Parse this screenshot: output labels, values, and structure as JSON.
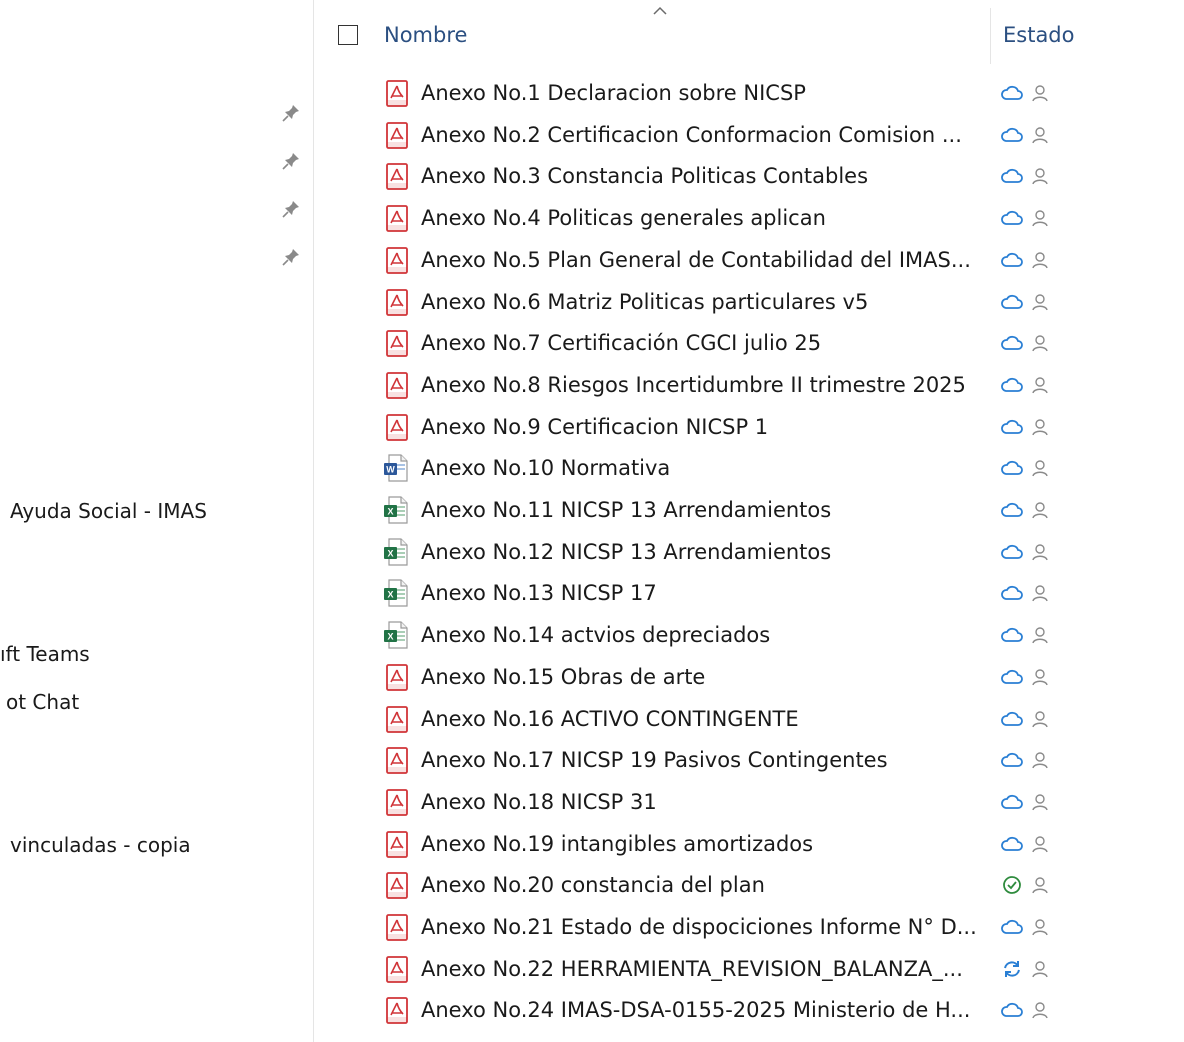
{
  "nav": {
    "items": [
      {
        "label": "Ayuda Social - IMAS"
      },
      {
        "label": "ıft Teams"
      },
      {
        "label": "ot Chat"
      },
      {
        "label": "vinculadas - copia"
      }
    ]
  },
  "header": {
    "name_label": "Nombre",
    "status_label": "Estado"
  },
  "files": [
    {
      "name": "Anexo No.1 Declaracion sobre NICSP",
      "type": "pdf",
      "status": "cloud"
    },
    {
      "name": "Anexo No.2 Certificacion Conformacion Comision ...",
      "type": "pdf",
      "status": "cloud"
    },
    {
      "name": "Anexo No.3 Constancia  Politicas Contables",
      "type": "pdf",
      "status": "cloud"
    },
    {
      "name": "Anexo No.4 Politicas generales aplican",
      "type": "pdf",
      "status": "cloud"
    },
    {
      "name": "Anexo No.5 Plan General de Contabilidad del IMAS...",
      "type": "pdf",
      "status": "cloud"
    },
    {
      "name": "Anexo No.6 Matriz Politicas particulares v5",
      "type": "pdf",
      "status": "cloud"
    },
    {
      "name": "Anexo No.7 Certificación CGCI julio 25",
      "type": "pdf",
      "status": "cloud"
    },
    {
      "name": "Anexo No.8 Riesgos Incertidumbre II trimestre 2025",
      "type": "pdf",
      "status": "cloud"
    },
    {
      "name": "Anexo No.9 Certificacion NICSP 1",
      "type": "pdf",
      "status": "cloud"
    },
    {
      "name": "Anexo No.10  Normativa",
      "type": "word",
      "status": "cloud"
    },
    {
      "name": "Anexo No.11 NICSP 13 Arrendamientos",
      "type": "excel",
      "status": "cloud"
    },
    {
      "name": "Anexo No.12 NICSP 13 Arrendamientos",
      "type": "excel",
      "status": "cloud"
    },
    {
      "name": "Anexo No.13 NICSP 17",
      "type": "excel",
      "status": "cloud"
    },
    {
      "name": "Anexo No.14 actvios depreciados",
      "type": "excel",
      "status": "cloud"
    },
    {
      "name": "Anexo No.15  Obras de arte",
      "type": "pdf",
      "status": "cloud"
    },
    {
      "name": "Anexo No.16 ACTIVO CONTINGENTE",
      "type": "pdf",
      "status": "cloud"
    },
    {
      "name": "Anexo No.17  NICSP 19 Pasivos Contingentes",
      "type": "pdf",
      "status": "cloud"
    },
    {
      "name": "Anexo No.18 NICSP 31",
      "type": "pdf",
      "status": "cloud"
    },
    {
      "name": "Anexo No.19 intangibles amortizados",
      "type": "pdf",
      "status": "cloud"
    },
    {
      "name": "Anexo No.20 constancia del plan",
      "type": "pdf",
      "status": "synced"
    },
    {
      "name": "Anexo No.21 Estado de dispociciones Informe N° D...",
      "type": "pdf",
      "status": "cloud"
    },
    {
      "name": "Anexo No.22 HERRAMIENTA_REVISION_BALANZA_...",
      "type": "pdf",
      "status": "syncing"
    },
    {
      "name": "Anexo No.24 IMAS-DSA-0155-2025 Ministerio de H...",
      "type": "pdf",
      "status": "cloud"
    }
  ],
  "colors": {
    "accent": "#2b4f81",
    "cloud": "#2a7fd4",
    "synced": "#2e8b3d",
    "pdf": "#d13438",
    "word": "#2b579a",
    "excel": "#217346"
  }
}
